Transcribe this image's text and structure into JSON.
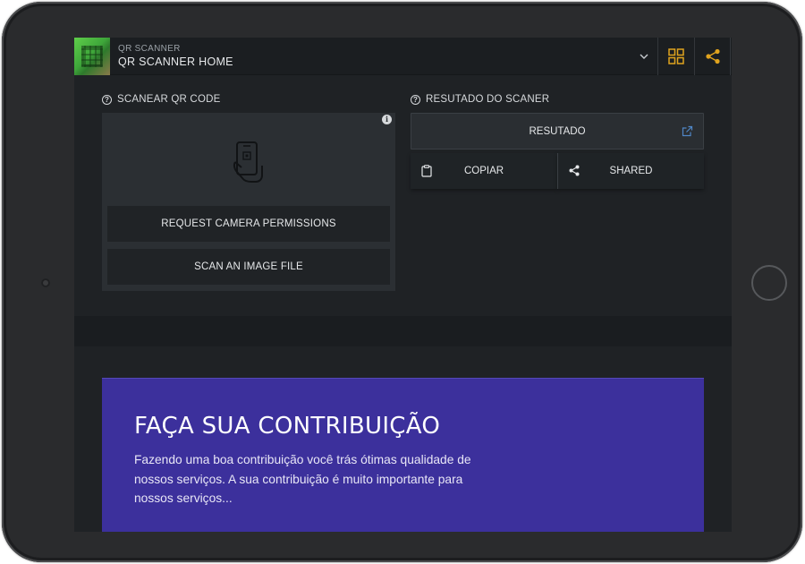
{
  "app": {
    "subtitle": "QR SCANNER",
    "title": "QR SCANNER HOME",
    "icons": {
      "menu": "chevron-down-icon",
      "grid": "grid-icon",
      "share": "share-icon"
    },
    "accent_color": "#e0a31e"
  },
  "scanner": {
    "section_title": "SCANEAR QR CODE",
    "request_camera_label": "REQUEST CAMERA PERMISSIONS",
    "scan_file_label": "SCAN AN IMAGE FILE"
  },
  "result": {
    "section_title": "RESUTADO DO SCANER",
    "result_label": "RESUTADO",
    "copy_label": "COPIAR",
    "share_label": "SHARED"
  },
  "contribution": {
    "title": "FAÇA SUA CONTRIBUIÇÃO",
    "text": "Fazendo uma boa contribuição você trás ótimas qualidade de nossos serviços. A sua contribuição é muito importante para nossos serviços..."
  },
  "colors": {
    "bezel": "#2a2b2d",
    "screen_bg": "#1f2225",
    "card_bg": "#2b2f33",
    "contribution_bg": "#3c309c"
  }
}
